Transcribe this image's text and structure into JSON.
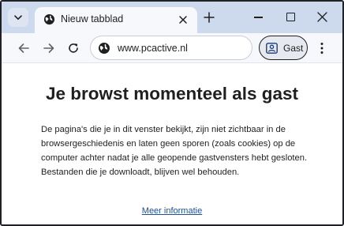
{
  "tabstrip": {
    "tab": {
      "title": "Nieuw tabblad"
    }
  },
  "toolbar": {
    "url": "www.pcactive.nl",
    "profile_label": "Gast"
  },
  "content": {
    "heading": "Je browst momenteel als gast",
    "paragraph": "De pagina's die je in dit venster bekijkt, zijn niet zichtbaar in de browsergeschiedenis en laten geen sporen (zoals cookies) op de computer achter nadat je alle geopende gastvensters hebt gesloten. Bestanden die je downloadt, blijven wel behouden.",
    "learn_more": "Meer informatie"
  },
  "icons": {
    "tab_search": "chevron-down-icon",
    "tab_favicon": "globe-icon",
    "tab_close": "close-icon",
    "new_tab": "plus-icon",
    "back": "arrow-left-icon",
    "forward": "arrow-right-icon",
    "reload": "reload-icon",
    "site_info": "site-info-icon",
    "profile": "person-icon",
    "menu": "more-vert-icon"
  },
  "colors": {
    "tabstrip_bg": "#cdd9ec",
    "toolbar_bg": "#f7f8fb",
    "link": "#1a4f9c"
  }
}
